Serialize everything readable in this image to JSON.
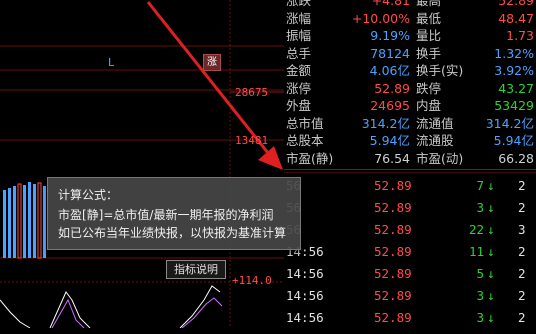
{
  "chart": {
    "price_labels": [
      "28675",
      "13481",
      "+114.0"
    ],
    "marker_L": "L",
    "marker_sell": "涨",
    "indicator_button": "指标说明"
  },
  "tooltip": {
    "title": "计算公式：",
    "line1": "市盈[静]=总市值/最新一期年报的净利润",
    "line2": "如已公布当年业绩快报，以快报为基准计算"
  },
  "quote": {
    "rows": [
      {
        "k1": "涨跌",
        "v1": "+4.81",
        "c1": "#ff4b4b",
        "k2": "最高",
        "v2": "52.89",
        "c2": "#ff4b4b"
      },
      {
        "k1": "涨幅",
        "v1": "+10.00%",
        "c1": "#ff4b4b",
        "k2": "最低",
        "v2": "48.47",
        "c2": "#ff4b4b"
      },
      {
        "k1": "振幅",
        "v1": "9.19%",
        "c1": "#4aa3ff",
        "k2": "量比",
        "v2": "1.73",
        "c2": "#ff4b4b"
      },
      {
        "k1": "总手",
        "v1": "78124",
        "c1": "#4aa3ff",
        "k2": "换手",
        "v2": "1.32%",
        "c2": "#4aa3ff"
      },
      {
        "k1": "金额",
        "v1": "4.06亿",
        "c1": "#4aa3ff",
        "k2": "换手(实)",
        "v2": "3.92%",
        "c2": "#4aa3ff"
      },
      {
        "k1": "涨停",
        "v1": "52.89",
        "c1": "#ff4b4b",
        "k2": "跌停",
        "v2": "43.27",
        "c2": "#2ad52a"
      },
      {
        "k1": "外盘",
        "v1": "24695",
        "c1": "#ff4b4b",
        "k2": "内盘",
        "v2": "53429",
        "c2": "#2ad52a"
      },
      {
        "k1": "总市值",
        "v1": "314.2亿",
        "c1": "#4aa3ff",
        "k2": "流通值",
        "v2": "314.2亿",
        "c2": "#4aa3ff"
      },
      {
        "k1": "总股本",
        "v1": "5.94亿",
        "c1": "#4aa3ff",
        "k2": "流通股",
        "v2": "5.94亿",
        "c2": "#4aa3ff"
      },
      {
        "k1": "市盈(静)",
        "v1": "76.54",
        "c1": "#d0d0d0",
        "k2": "市盈(动)",
        "v2": "66.28",
        "c2": "#d0d0d0"
      }
    ],
    "ticks": [
      {
        "t": "56",
        "p": "52.89",
        "v": "7",
        "n": "2"
      },
      {
        "t": "56",
        "p": "52.89",
        "v": "3",
        "n": "2"
      },
      {
        "t": "56",
        "p": "52.89",
        "v": "22",
        "n": "3"
      },
      {
        "t": "14:56",
        "p": "52.89",
        "v": "11",
        "n": "2"
      },
      {
        "t": "14:56",
        "p": "52.89",
        "v": "5",
        "n": "2"
      },
      {
        "t": "14:56",
        "p": "52.89",
        "v": "3",
        "n": "2"
      },
      {
        "t": "14:56",
        "p": "52.89",
        "v": "3",
        "n": "2"
      }
    ],
    "arrow": "↓",
    "arrow_color": "#2ad52a"
  }
}
